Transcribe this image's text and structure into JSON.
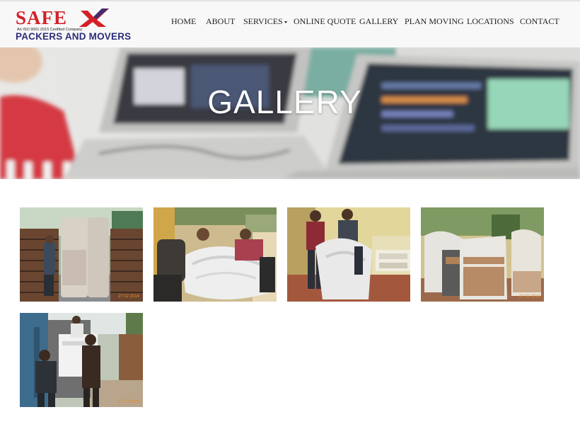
{
  "logo": {
    "word": "SAFE",
    "tagline": "An ISO 9001:2015 Certified Company",
    "subtitle": "PACKERS AND MOVERS",
    "colors": {
      "red": "#d42027",
      "navy": "#2b2e7a"
    }
  },
  "nav": {
    "items": [
      {
        "label": "HOME"
      },
      {
        "label": "ABOUT"
      },
      {
        "label": "SERVICES",
        "has_dropdown": true
      },
      {
        "label": "ONLINE QUOTE"
      },
      {
        "label": "GALLERY"
      },
      {
        "label": "PLAN MOVING"
      },
      {
        "label": "LOCATIONS"
      },
      {
        "label": "CONTACT"
      }
    ]
  },
  "banner": {
    "title": "GALLERY"
  },
  "gallery": {
    "photos": [
      {
        "subject": "truck-loading",
        "stamp": "27 02 2014"
      },
      {
        "subject": "men-wrapping-sofa",
        "stamp": ""
      },
      {
        "subject": "men-lifting-wrapped-chair",
        "stamp": ""
      },
      {
        "subject": "wrapped-furniture-outdoors",
        "stamp": "27 02 2014"
      },
      {
        "subject": "loading-into-truck",
        "stamp": "27 02 2014"
      }
    ]
  }
}
